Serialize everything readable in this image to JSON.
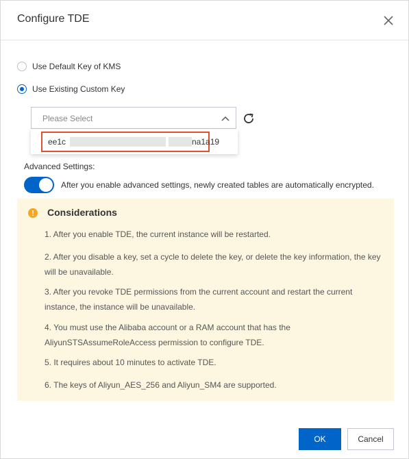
{
  "dialog": {
    "title": "Configure TDE",
    "close_icon": "close-icon"
  },
  "key_source": {
    "options": [
      {
        "label": "Use Default Key of KMS",
        "selected": false
      },
      {
        "label": "Use Existing Custom Key",
        "selected": true
      }
    ]
  },
  "key_select": {
    "placeholder": "Please Select",
    "chevron_icon": "chevron-up-icon",
    "refresh_icon": "refresh-icon",
    "dropdown_option_prefix": "ee1c",
    "dropdown_option_suffix": "na1a19"
  },
  "advanced": {
    "label": "Advanced Settings:",
    "switch_on": true,
    "description": "After you enable advanced settings, newly created tables are automatically encrypted."
  },
  "considerations": {
    "icon": "warning-icon",
    "title": "Considerations",
    "items": [
      "1. After you enable TDE, the current instance will be restarted.",
      "2. After you disable a key, set a cycle to delete the key, or delete the key information, the key will be unavailable.",
      "3. After you revoke TDE permissions from the current account and restart the current instance, the instance will be unavailable.",
      "4. You must use the Alibaba account or a RAM account that has the AliyunSTSAssumeRoleAccess permission to configure TDE.",
      "5. It requires about 10 minutes to activate TDE.",
      "6. The keys of Aliyun_AES_256 and Aliyun_SM4 are supported."
    ]
  },
  "footer": {
    "ok_label": "OK",
    "cancel_label": "Cancel"
  },
  "colors": {
    "primary": "#0064c8",
    "highlight_border": "#e04f2f",
    "notice_bg": "#fdf6e1",
    "warning": "#f5a623"
  }
}
